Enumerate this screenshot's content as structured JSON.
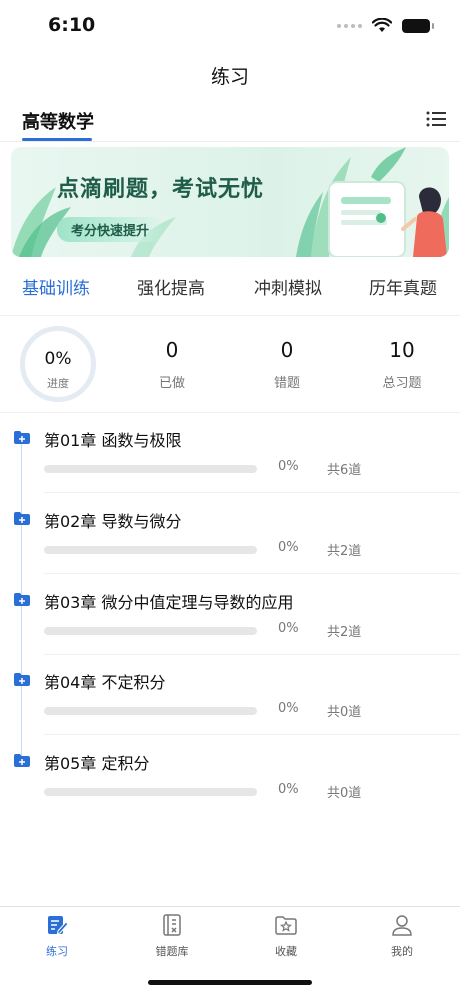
{
  "status_bar": {
    "time": "6:10"
  },
  "nav": {
    "title": "练习"
  },
  "subject": {
    "label": "高等数学"
  },
  "banner": {
    "title": "点滴刷题，考试无忧",
    "tagline": "考分快速提升"
  },
  "tabs": [
    {
      "label": "基础训练",
      "active": true
    },
    {
      "label": "强化提高",
      "active": false
    },
    {
      "label": "冲刺模拟",
      "active": false
    },
    {
      "label": "历年真题",
      "active": false
    }
  ],
  "stats": {
    "progress": {
      "value": "0%",
      "label": "进度"
    },
    "done": {
      "value": "0",
      "label": "已做"
    },
    "wrong": {
      "value": "0",
      "label": "错题"
    },
    "total": {
      "value": "10",
      "label": "总习题"
    }
  },
  "chapters": [
    {
      "title": "第01章 函数与极限",
      "progress_fraction": 0,
      "percent_text": "0%",
      "count_text": "共6道"
    },
    {
      "title": "第02章 导数与微分",
      "progress_fraction": 0,
      "percent_text": "0%",
      "count_text": "共2道"
    },
    {
      "title": "第03章 微分中值定理与导数的应用",
      "progress_fraction": 0,
      "percent_text": "0%",
      "count_text": "共2道"
    },
    {
      "title": "第04章 不定积分",
      "progress_fraction": 0,
      "percent_text": "0%",
      "count_text": "共0道"
    },
    {
      "title": "第05章 定积分",
      "progress_fraction": 0,
      "percent_text": "0%",
      "count_text": "共0道"
    }
  ],
  "tabbar": [
    {
      "label": "练习",
      "icon": "edit-note-icon",
      "active": true
    },
    {
      "label": "错题库",
      "icon": "error-book-icon",
      "active": false
    },
    {
      "label": "收藏",
      "icon": "star-folder-icon",
      "active": false
    },
    {
      "label": "我的",
      "icon": "user-icon",
      "active": false
    }
  ],
  "colors": {
    "accent": "#2a6fd6",
    "banner_text": "#1f5c49"
  }
}
